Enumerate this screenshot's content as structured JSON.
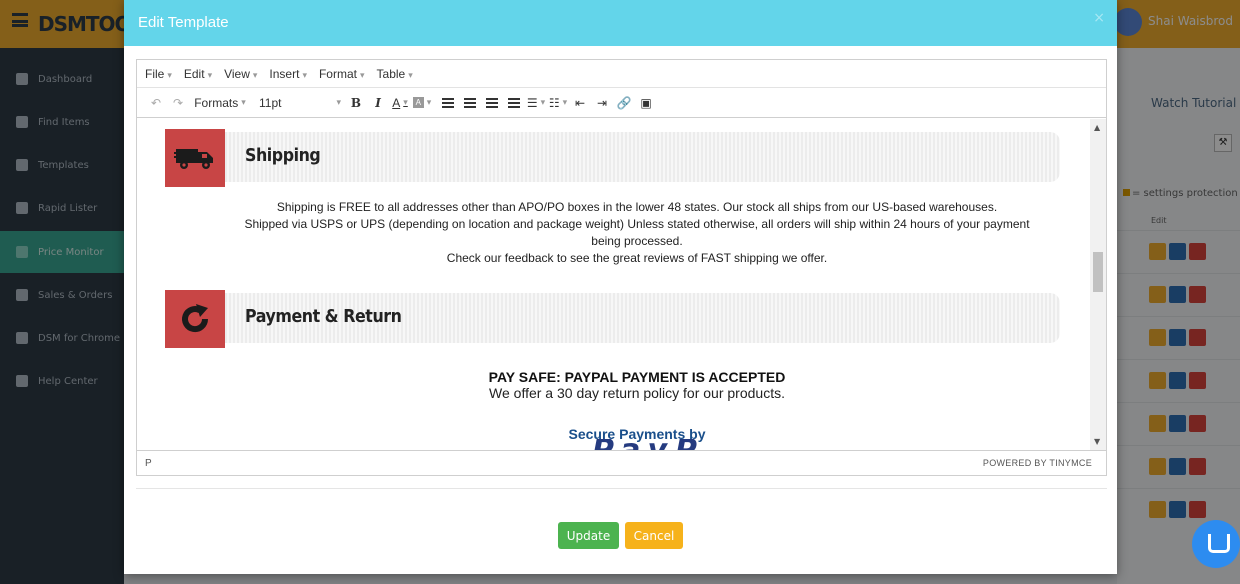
{
  "app": {
    "logo": "DSMTOOL",
    "user_name": "Shai Waisbrod",
    "sidebar": [
      {
        "label": "Dashboard",
        "active": false
      },
      {
        "label": "Find Items",
        "active": false
      },
      {
        "label": "Templates",
        "active": false
      },
      {
        "label": "Rapid Lister",
        "active": false
      },
      {
        "label": "Price Monitor",
        "active": true
      },
      {
        "label": "Sales & Orders",
        "active": false
      },
      {
        "label": "DSM for Chrome",
        "active": false
      },
      {
        "label": "Help Center",
        "active": false
      }
    ],
    "right_pane": {
      "tutorial": "Watch Tutorial ?",
      "settings_protection": "= settings protection",
      "edit_label": "Edit"
    }
  },
  "modal": {
    "title": "Edit Template",
    "close": "×",
    "menubar": [
      "File",
      "Edit",
      "View",
      "Insert",
      "Format",
      "Table"
    ],
    "toolbar": {
      "formats": "Formats",
      "font_size": "11pt",
      "bold": "B",
      "italic": "I",
      "font_color": "A",
      "bg_color": "A"
    },
    "content": {
      "shipping_title": "Shipping",
      "shipping_lines": [
        "Shipping is FREE to all addresses other than APO/PO boxes in the lower 48 states. Our stock all ships from our US-based warehouses.",
        "Shipped via USPS or UPS (depending on location and package weight) Unless stated otherwise, all orders will ship within 24 hours of your payment",
        "being processed.",
        "Check our feedback to see the great reviews of FAST shipping we offer."
      ],
      "payment_title": "Payment & Return",
      "pay_heading": "PAY SAFE: PAYPAL PAYMENT IS ACCEPTED",
      "pay_sub": "We offer a 30 day return policy for our products.",
      "secure_payments": "Secure Payments by",
      "paypal_peek": "PayPal"
    },
    "statusbar": {
      "path": "P",
      "powered": "POWERED BY TINYMCE"
    },
    "buttons": {
      "update": "Update",
      "cancel": "Cancel"
    }
  },
  "colors": {
    "header": "#63d5ea",
    "topbar": "#f0ae2f",
    "sidebar": "#2f3b46",
    "section_icon": "#c84545",
    "update": "#4cb34f",
    "cancel": "#f6b21b"
  }
}
